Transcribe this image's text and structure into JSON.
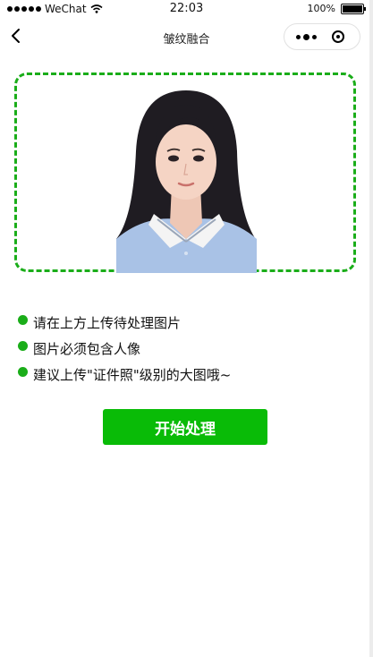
{
  "status_bar": {
    "carrier": "WeChat",
    "time": "22:03",
    "battery": "100%"
  },
  "nav": {
    "title": "皱纹融合"
  },
  "upload": {
    "accent": "#1aad19"
  },
  "tips": [
    "请在上方上传待处理图片",
    "图片必须包含人像",
    "建议上传\"证件照\"级别的大图哦~"
  ],
  "start_button": {
    "label": "开始处理",
    "color": "#09bb07"
  }
}
